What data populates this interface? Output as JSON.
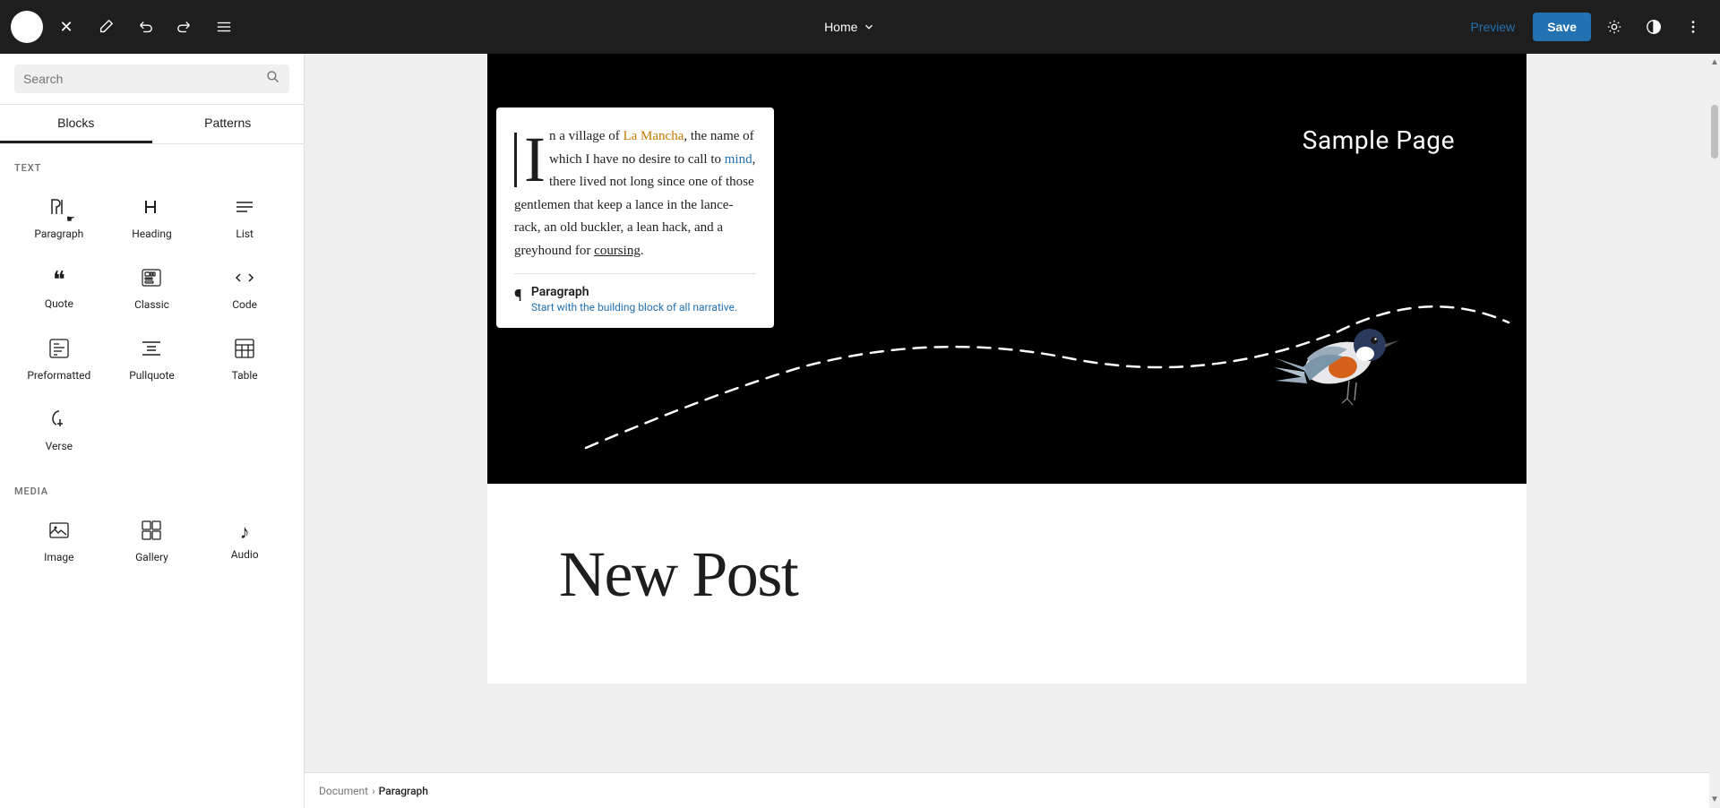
{
  "topbar": {
    "wp_logo": "W",
    "close_label": "×",
    "edit_icon": "✏",
    "undo_icon": "↩",
    "redo_icon": "↪",
    "menu_icon": "≡",
    "page_name": "Home",
    "chevron_icon": "∨",
    "preview_label": "Preview",
    "save_label": "Save",
    "settings_icon": "⚙",
    "contrast_icon": "◑",
    "more_icon": "⋮"
  },
  "sidebar": {
    "search_placeholder": "Search",
    "search_icon": "🔍",
    "tabs": [
      {
        "label": "Blocks",
        "active": true
      },
      {
        "label": "Patterns",
        "active": false
      }
    ],
    "sections": [
      {
        "label": "TEXT",
        "blocks": [
          {
            "id": "paragraph",
            "icon": "¶",
            "label": "Paragraph"
          },
          {
            "id": "heading",
            "icon": "🔖",
            "label": "Heading"
          },
          {
            "id": "list",
            "icon": "≡",
            "label": "List"
          },
          {
            "id": "quote",
            "icon": "❝",
            "label": "Quote"
          },
          {
            "id": "classic",
            "icon": "⌨",
            "label": "Classic"
          },
          {
            "id": "code",
            "icon": "<>",
            "label": "Code"
          },
          {
            "id": "preformatted",
            "icon": "▤",
            "label": "Preformatted"
          },
          {
            "id": "pullquote",
            "icon": "▬",
            "label": "Pullquote"
          },
          {
            "id": "table",
            "icon": "⊞",
            "label": "Table"
          },
          {
            "id": "verse",
            "icon": "✒",
            "label": "Verse"
          }
        ]
      },
      {
        "label": "MEDIA",
        "blocks": [
          {
            "id": "image",
            "icon": "🖼",
            "label": "Image"
          },
          {
            "id": "gallery",
            "icon": "▣",
            "label": "Gallery"
          },
          {
            "id": "audio",
            "icon": "♪",
            "label": "Audio"
          }
        ]
      }
    ]
  },
  "canvas": {
    "hero": {
      "sample_page_label": "Sample Page",
      "paragraph_text_parts": [
        {
          "text": "n a village of La Mancha, the name of which I have no desire to call to mind, there lived not long since one of those gentlemen that keep a lance in the lance-rack, an old buckler, a lean hack, and a greyhound for coursing."
        }
      ],
      "drop_cap": "I"
    },
    "tooltip": {
      "icon": "¶",
      "title": "Paragraph",
      "desc": "Start with the building block of all narrative."
    },
    "new_post_title": "New Post"
  },
  "breadcrumb": {
    "items": [
      {
        "label": "Document",
        "current": false
      },
      {
        "label": "›",
        "sep": true
      },
      {
        "label": "Paragraph",
        "current": true
      }
    ]
  }
}
